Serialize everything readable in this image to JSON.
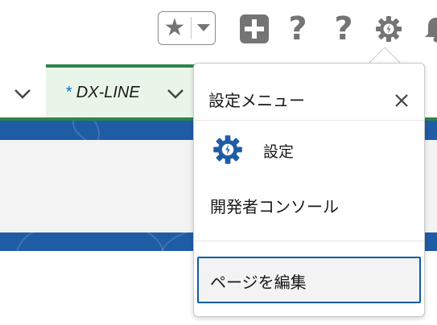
{
  "header": {
    "favorites_star": "★",
    "favorites_menu": "▾",
    "add_glyph": "+",
    "help_glyph": "?",
    "icons": [
      "favorites-star-icon",
      "chevron-down-icon",
      "plus-icon",
      "help-icon",
      "help-icon",
      "gear-icon",
      "bell-icon"
    ]
  },
  "nav": {
    "tab": {
      "marker": "*",
      "label": "DX-LINE"
    }
  },
  "setup_menu": {
    "title": "設定メニュー",
    "items": [
      {
        "label": "設定",
        "icon": "setup-gear-icon"
      },
      {
        "label": "開発者コンソール"
      },
      {
        "label": "ページを編集"
      }
    ]
  },
  "colors": {
    "accent_green": "#2e844a",
    "brand_blue": "#1f5ca6",
    "icon_gray": "#747474",
    "focus_blue": "#0b5cab"
  }
}
